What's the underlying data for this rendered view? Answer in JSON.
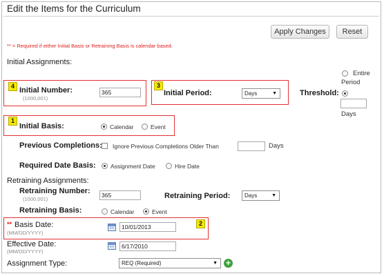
{
  "title": "Edit the Items for the Curriculum",
  "buttons": {
    "apply": "Apply Changes",
    "reset": "Reset"
  },
  "required_note": "** = Required if either Initial Basis or Retraining Basis is calendar based.",
  "initial_section": "Initial Assignments:",
  "initial_number": {
    "label": "Initial Number:",
    "range": "(1000,001)",
    "value": "365",
    "badge": "4"
  },
  "initial_period": {
    "label": "Initial Period:",
    "value": "Days",
    "badge": "3"
  },
  "threshold": {
    "label": "Threshold:",
    "option_entire": "Entire",
    "option_period": "Period",
    "days_label": "Days",
    "value": ""
  },
  "initial_basis": {
    "label": "Initial Basis:",
    "opt_calendar": "Calendar",
    "opt_event": "Event",
    "selected": "Calendar",
    "badge": "1"
  },
  "previous_completions": {
    "label": "Previous Completions:",
    "text": "Ignore Previous Completions Older Than",
    "value": "",
    "unit": "Days"
  },
  "required_date_basis": {
    "label": "Required Date Basis:",
    "opt_assignment": "Assignment Date",
    "opt_hire": "Hire Date",
    "selected": "Assignment Date"
  },
  "retraining_section": "Retraining Assignments:",
  "retraining_number": {
    "label": "Retraining Number:",
    "range": "(1000,001)",
    "value": "365"
  },
  "retraining_period": {
    "label": "Retraining Period:",
    "value": "Days"
  },
  "retraining_basis": {
    "label": "Retraining Basis:",
    "opt_calendar": "Calendar",
    "opt_event": "Event",
    "selected": "Event"
  },
  "basis_date": {
    "required_mark": "**",
    "label": "Basis Date:",
    "format": "(MM/DD/YYYY)",
    "value": "10/01/2013",
    "badge": "2"
  },
  "effective_date": {
    "label": "Effective Date:",
    "format": "(MM/DD/YYYY)",
    "value": "6/17/2010"
  },
  "assignment_type": {
    "label": "Assignment Type:",
    "value": "REQ (Required)"
  },
  "colors": {
    "annotation_red": "#e23030",
    "badge_yellow": "#f5e800",
    "add_green": "#3ea23e"
  }
}
